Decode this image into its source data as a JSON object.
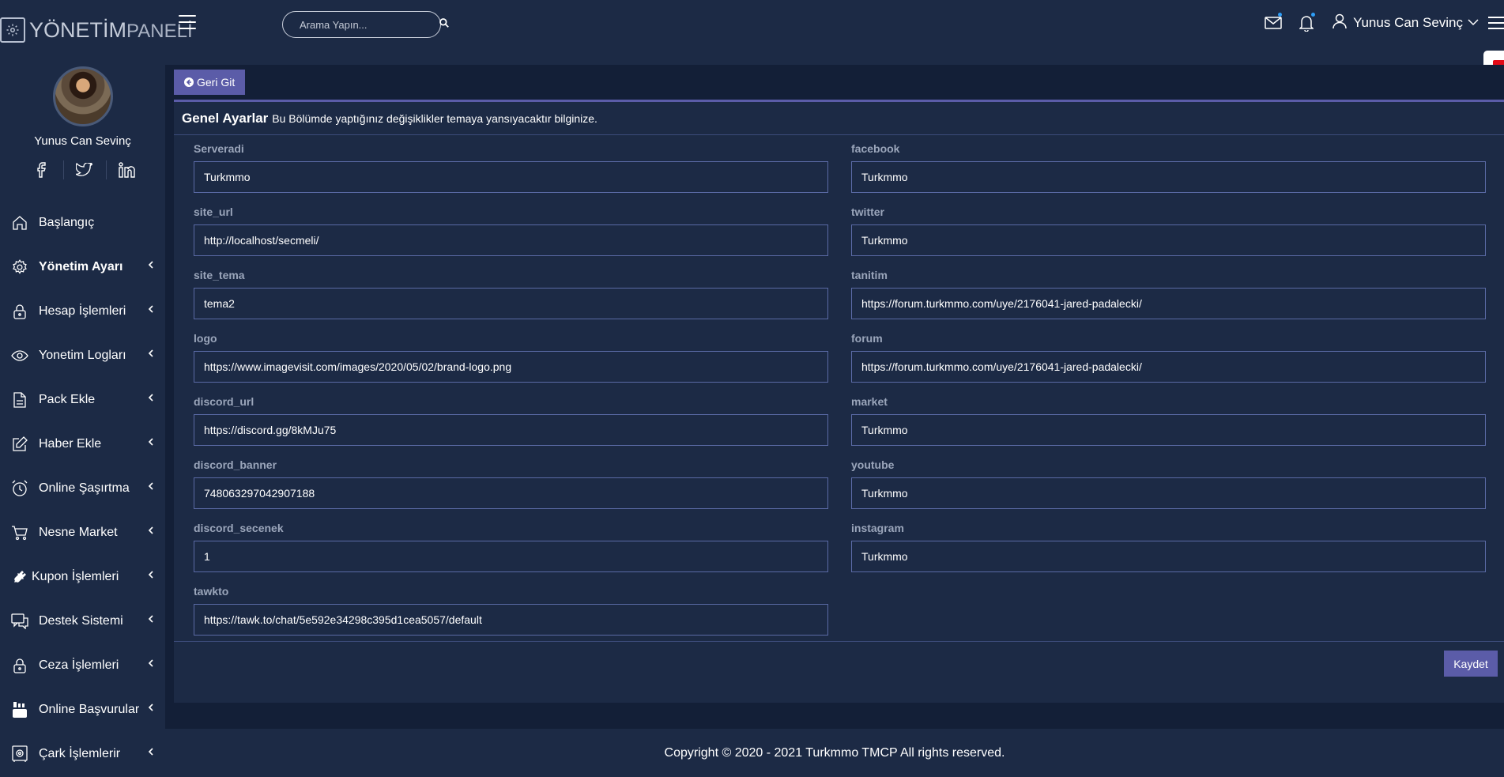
{
  "brand": {
    "logo_bold": "YÖNETİM",
    "logo_thin": "PANELİ"
  },
  "search": {
    "placeholder": "Arama Yapın..."
  },
  "user": {
    "name": "Yunus Can Sevinç"
  },
  "profile": {
    "name": "Yunus Can Sevinç"
  },
  "sidebar": {
    "items": [
      {
        "label": "Başlangıç",
        "icon": "home-icon"
      },
      {
        "label": "Yönetim Ayarı",
        "icon": "gear-icon"
      },
      {
        "label": "Hesap İşlemleri",
        "icon": "lock-icon"
      },
      {
        "label": "Yonetim Logları",
        "icon": "eye-icon"
      },
      {
        "label": "Pack Ekle",
        "icon": "file-icon"
      },
      {
        "label": "Haber Ekle",
        "icon": "edit-icon"
      },
      {
        "label": "Online Şaşırtma",
        "icon": "alarm-icon"
      },
      {
        "label": "Nesne Market",
        "icon": "cart-icon"
      },
      {
        "label": "Kupon İşlemleri",
        "icon": "plug-icon"
      },
      {
        "label": "Destek Sistemi",
        "icon": "chat-icon"
      },
      {
        "label": "Ceza İşlemleri",
        "icon": "lock-icon"
      },
      {
        "label": "Online Başvurular",
        "icon": "youtube-icon"
      },
      {
        "label": "Çark İşlemlerir",
        "icon": "safe-icon"
      }
    ]
  },
  "content": {
    "back_label": "Geri Git",
    "card_title": "Genel Ayarlar",
    "card_desc": "Bu Bölümde yaptığınız değişiklikler temaya yansıyacaktır bilginize.",
    "save_label": "Kaydet",
    "left_fields": [
      {
        "label": "Serveradi",
        "value": "Turkmmo"
      },
      {
        "label": "site_url",
        "value": "http://localhost/secmeli/"
      },
      {
        "label": "site_tema",
        "value": "tema2"
      },
      {
        "label": "logo",
        "value": "https://www.imagevisit.com/images/2020/05/02/brand-logo.png"
      },
      {
        "label": "discord_url",
        "value": "https://discord.gg/8kMJu75"
      },
      {
        "label": "discord_banner",
        "value": "748063297042907188"
      },
      {
        "label": "discord_secenek",
        "value": "1"
      },
      {
        "label": "tawkto",
        "value": "https://tawk.to/chat/5e592e34298c395d1cea5057/default"
      }
    ],
    "right_fields": [
      {
        "label": "facebook",
        "value": "Turkmmo"
      },
      {
        "label": "twitter",
        "value": "Turkmmo"
      },
      {
        "label": "tanitim",
        "value": "https://forum.turkmmo.com/uye/2176041-jared-padalecki/"
      },
      {
        "label": "forum",
        "value": "https://forum.turkmmo.com/uye/2176041-jared-padalecki/"
      },
      {
        "label": "market",
        "value": "Turkmmo"
      },
      {
        "label": "youtube",
        "value": "Turkmmo"
      },
      {
        "label": "instagram",
        "value": "Turkmmo"
      }
    ]
  },
  "footer": {
    "text": "Copyright © 2020 - 2021 Turkmmo TMCP All rights reserved."
  },
  "colors": {
    "background": "#1c2a45",
    "content_bg": "#131f37",
    "accent": "#5b5ca8",
    "input_border": "#5a6aa5",
    "notification_dot": "#2e9ef7"
  }
}
